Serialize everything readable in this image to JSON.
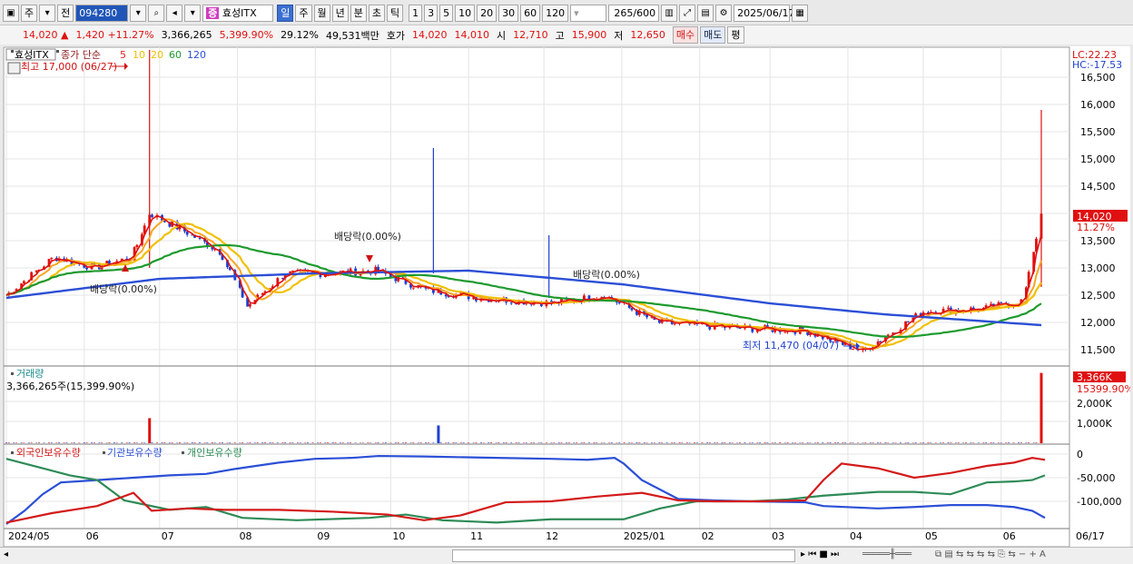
{
  "toolbar": {
    "period_tab": "주",
    "prev_label": "전",
    "code": "094280",
    "name": "효성ITX",
    "period_buttons": [
      "일",
      "주",
      "월",
      "년",
      "분",
      "초",
      "틱"
    ],
    "minute_buttons": [
      "1",
      "3",
      "5",
      "10",
      "20",
      "30",
      "60",
      "120"
    ],
    "count_value": "265",
    "count_max": "600",
    "date": "2025/06/17"
  },
  "info": {
    "price": "14,020",
    "arrow": "▲",
    "change": "1,420",
    "change_pct": "+11.27%",
    "volume": "3,366,265",
    "vol_pct": "5,399.90%",
    "turnover": "29.12%",
    "amount": "49,531백만",
    "ask_label": "호가",
    "ask1": "14,020",
    "ask2": "14,010",
    "open_label": "시",
    "open": "12,710",
    "high_label": "고",
    "high": "15,900",
    "low_label": "저",
    "low": "12,650",
    "buy": "매수",
    "sell": "매도",
    "eval": "평"
  },
  "panels": {
    "price": {
      "name": "효성ITX",
      "legend": "종가 단순",
      "ma": [
        {
          "label": "5",
          "color": "#e11f1f"
        },
        {
          "label": "10",
          "color": "#f0c000"
        },
        {
          "label": "20",
          "color": "#f0c000"
        },
        {
          "label": "60",
          "color": "#1d9a2e"
        },
        {
          "label": "120",
          "color": "#2b4fd6"
        }
      ],
      "lc": "LC:22.23",
      "hc": "HC:-17.53",
      "ticks": [
        "16,500",
        "16,000",
        "15,500",
        "15,000",
        "14,500",
        "14,000",
        "13,500",
        "13,000",
        "12,500",
        "12,000",
        "11,500"
      ],
      "current": "14,020",
      "current_pct": "11.27%",
      "high_note": "최고 17,000 (06/27)",
      "low_note": "최저 11,470 (04/07)",
      "div1": "배당락(0.00%)",
      "div2": "배당락(0.00%)",
      "div3": "배당락(0.00%)"
    },
    "volume": {
      "title": "거래량",
      "summary": "3,366,265주(15,399.90%)",
      "ticks": [
        "2,000K",
        "1,000K"
      ],
      "current": "3,366K",
      "current_pct": "15399.90%"
    },
    "holdings": {
      "legend": [
        "외국인보유수량",
        "기관보유수량",
        "개인보유수량"
      ],
      "colors": [
        "#d41a1a",
        "#2b4fd6",
        "#2e8b57"
      ],
      "ticks": [
        "0",
        "-50,000",
        "-100,000"
      ]
    }
  },
  "xaxis": [
    "2024/05",
    "06",
    "07",
    "08",
    "09",
    "10",
    "11",
    "12",
    "2025/01",
    "02",
    "03",
    "04",
    "05",
    "06",
    "06/17"
  ],
  "chart_data": [
    {
      "type": "line",
      "title": "효성ITX",
      "series": [
        {
          "name": "종가",
          "points": [
            [
              "2024-05-01",
              12500
            ],
            [
              "2024-05-20",
              13200
            ],
            [
              "2024-06-05",
              13000
            ],
            [
              "2024-06-20",
              13200
            ],
            [
              "2024-06-27",
              14000
            ],
            [
              "2024-07-10",
              13700
            ],
            [
              "2024-07-25",
              13300
            ],
            [
              "2024-08-05",
              12300
            ],
            [
              "2024-08-20",
              12900
            ],
            [
              "2024-09-05",
              12900
            ],
            [
              "2024-09-25",
              12950
            ],
            [
              "2024-10-15",
              12600
            ],
            [
              "2024-11-05",
              12450
            ],
            [
              "2024-12-05",
              12350
            ],
            [
              "2024-12-25",
              12500
            ],
            [
              "2025-01-15",
              12000
            ],
            [
              "2025-02-15",
              11900
            ],
            [
              "2025-03-15",
              11850
            ],
            [
              "2025-04-07",
              11470
            ],
            [
              "2025-05-01",
              12200
            ],
            [
              "2025-05-25",
              12250
            ],
            [
              "2025-06-10",
              12400
            ],
            [
              "2025-06-17",
              14020
            ]
          ]
        },
        {
          "name": "120",
          "points": [
            [
              "2024-05-01",
              12450
            ],
            [
              "2024-07-01",
              12800
            ],
            [
              "2024-09-01",
              12900
            ],
            [
              "2024-11-01",
              12950
            ],
            [
              "2025-01-01",
              12700
            ],
            [
              "2025-03-01",
              12350
            ],
            [
              "2025-04-15",
              12150
            ],
            [
              "2025-06-17",
              11950
            ]
          ]
        }
      ],
      "ylim": [
        11300,
        16800
      ]
    },
    {
      "type": "bar",
      "title": "거래량",
      "series": [
        {
          "name": "거래량",
          "points": [
            [
              "2024-06-27",
              1200
            ],
            [
              "2024-10-20",
              850
            ],
            [
              "2025-06-17",
              3366
            ]
          ]
        }
      ]
    }
  ]
}
